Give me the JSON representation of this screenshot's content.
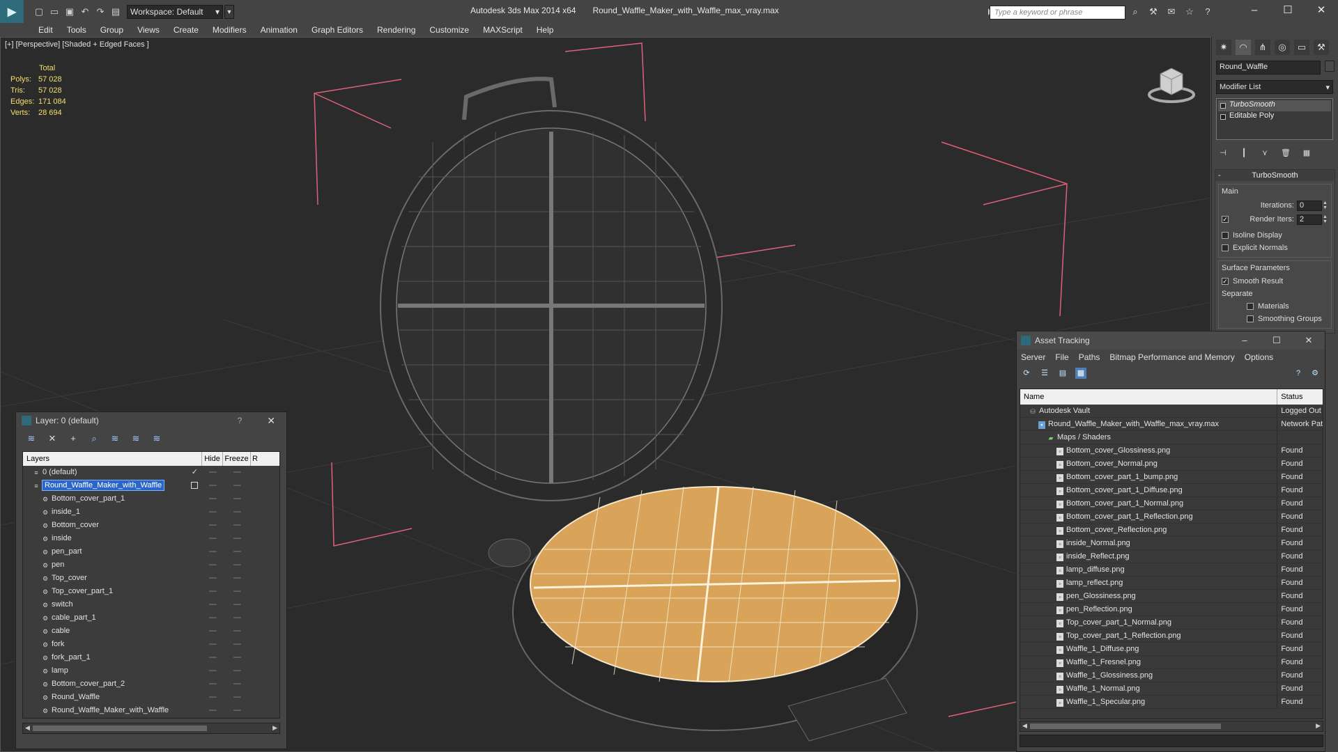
{
  "titlebar": {
    "workspace_label": "Workspace: Default",
    "app_name": "Autodesk 3ds Max  2014 x64",
    "file_name": "Round_Waffle_Maker_with_Waffle_max_vray.max",
    "search_placeholder": "Type a keyword or phrase"
  },
  "menu": [
    "Edit",
    "Tools",
    "Group",
    "Views",
    "Create",
    "Modifiers",
    "Animation",
    "Graph Editors",
    "Rendering",
    "Customize",
    "MAXScript",
    "Help"
  ],
  "viewport": {
    "label": "[+] [Perspective] [Shaded + Edged Faces ]",
    "stats": {
      "header": "Total",
      "rows": [
        {
          "k": "Polys:",
          "v": "57 028"
        },
        {
          "k": "Tris:",
          "v": "57 028"
        },
        {
          "k": "Edges:",
          "v": "171 084"
        },
        {
          "k": "Verts:",
          "v": "28 694"
        }
      ]
    }
  },
  "command_panel": {
    "object_name": "Round_Waffle",
    "modifier_list": "Modifier List",
    "stack": [
      "TurboSmooth",
      "Editable Poly"
    ],
    "rollout_title": "TurboSmooth",
    "main_group": "Main",
    "iterations_label": "Iterations:",
    "iterations_value": "0",
    "render_iters_label": "Render Iters:",
    "render_iters_value": "2",
    "isoline_display": "Isoline Display",
    "explicit_normals": "Explicit Normals",
    "surface_group": "Surface Parameters",
    "smooth_result": "Smooth Result",
    "separate": "Separate",
    "materials": "Materials",
    "smoothing_groups": "Smoothing Groups"
  },
  "asset_tracking": {
    "title": "Asset Tracking",
    "menu": [
      "Server",
      "File",
      "Paths",
      "Bitmap Performance and Memory",
      "Options"
    ],
    "col_name": "Name",
    "col_status": "Status",
    "rows": [
      {
        "name": "Autodesk Vault",
        "status": "Logged Out",
        "indent": 1,
        "icon": "vault"
      },
      {
        "name": "Round_Waffle_Maker_with_Waffle_max_vray.max",
        "status": "Network Path",
        "indent": 2,
        "icon": "max"
      },
      {
        "name": "Maps / Shaders",
        "status": "",
        "indent": 3,
        "icon": "maps"
      },
      {
        "name": "Bottom_cover_Glossiness.png",
        "status": "Found",
        "indent": 4,
        "icon": "file"
      },
      {
        "name": "Bottom_cover_Normal.png",
        "status": "Found",
        "indent": 4,
        "icon": "file"
      },
      {
        "name": "Bottom_cover_part_1_bump.png",
        "status": "Found",
        "indent": 4,
        "icon": "file"
      },
      {
        "name": "Bottom_cover_part_1_Diffuse.png",
        "status": "Found",
        "indent": 4,
        "icon": "file"
      },
      {
        "name": "Bottom_cover_part_1_Normal.png",
        "status": "Found",
        "indent": 4,
        "icon": "file"
      },
      {
        "name": "Bottom_cover_part_1_Reflection.png",
        "status": "Found",
        "indent": 4,
        "icon": "file"
      },
      {
        "name": "Bottom_cover_Reflection.png",
        "status": "Found",
        "indent": 4,
        "icon": "file"
      },
      {
        "name": "inside_Normal.png",
        "status": "Found",
        "indent": 4,
        "icon": "file"
      },
      {
        "name": "inside_Reflect.png",
        "status": "Found",
        "indent": 4,
        "icon": "file"
      },
      {
        "name": "lamp_diffuse.png",
        "status": "Found",
        "indent": 4,
        "icon": "file"
      },
      {
        "name": "lamp_reflect.png",
        "status": "Found",
        "indent": 4,
        "icon": "file"
      },
      {
        "name": "pen_Glossiness.png",
        "status": "Found",
        "indent": 4,
        "icon": "file"
      },
      {
        "name": "pen_Reflection.png",
        "status": "Found",
        "indent": 4,
        "icon": "file"
      },
      {
        "name": "Top_cover_part_1_Normal.png",
        "status": "Found",
        "indent": 4,
        "icon": "file"
      },
      {
        "name": "Top_cover_part_1_Reflection.png",
        "status": "Found",
        "indent": 4,
        "icon": "file"
      },
      {
        "name": "Waffle_1_Diffuse.png",
        "status": "Found",
        "indent": 4,
        "icon": "file"
      },
      {
        "name": "Waffle_1_Fresnel.png",
        "status": "Found",
        "indent": 4,
        "icon": "file"
      },
      {
        "name": "Waffle_1_Glossiness.png",
        "status": "Found",
        "indent": 4,
        "icon": "file"
      },
      {
        "name": "Waffle_1_Normal.png",
        "status": "Found",
        "indent": 4,
        "icon": "file"
      },
      {
        "name": "Waffle_1_Specular.png",
        "status": "Found",
        "indent": 4,
        "icon": "file"
      }
    ]
  },
  "layer_window": {
    "title": "Layer: 0 (default)",
    "help": "?",
    "col_layers": "Layers",
    "col_hide": "Hide",
    "col_freeze": "Freeze",
    "col_render": "R",
    "rows": [
      {
        "name": "0 (default)",
        "level": 1,
        "state": "default"
      },
      {
        "name": "Round_Waffle_Maker_with_Waffle",
        "level": 1,
        "state": "selected"
      },
      {
        "name": "Bottom_cover_part_1",
        "level": 2
      },
      {
        "name": "inside_1",
        "level": 2
      },
      {
        "name": "Bottom_cover",
        "level": 2
      },
      {
        "name": "inside",
        "level": 2
      },
      {
        "name": "pen_part",
        "level": 2
      },
      {
        "name": "pen",
        "level": 2
      },
      {
        "name": "Top_cover",
        "level": 2
      },
      {
        "name": "Top_cover_part_1",
        "level": 2
      },
      {
        "name": "switch",
        "level": 2
      },
      {
        "name": "cable_part_1",
        "level": 2
      },
      {
        "name": "cable",
        "level": 2
      },
      {
        "name": "fork",
        "level": 2
      },
      {
        "name": "fork_part_1",
        "level": 2
      },
      {
        "name": "lamp",
        "level": 2
      },
      {
        "name": "Bottom_cover_part_2",
        "level": 2
      },
      {
        "name": "Round_Waffle",
        "level": 2
      },
      {
        "name": "Round_Waffle_Maker_with_Waffle",
        "level": 2
      }
    ]
  },
  "colors": {
    "ui_bg": "#444444",
    "viewport_bg": "#2b2b2b",
    "stats_text": "#f2e06a",
    "selection": "#2a66c8",
    "waffle": "#d9a45a",
    "bounding_box": "#e0607a"
  }
}
